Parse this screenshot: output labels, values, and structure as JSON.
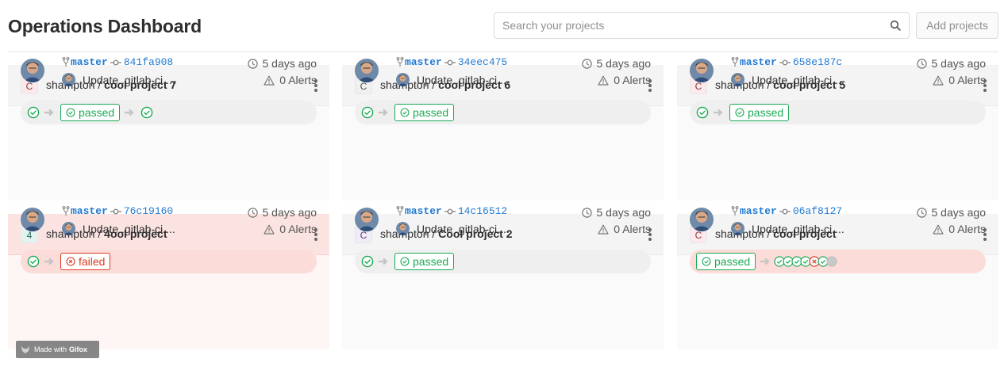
{
  "header": {
    "title": "Operations Dashboard",
    "search_placeholder": "Search your projects",
    "add_label": "Add projects"
  },
  "colors": {
    "passed": "#1aaa55",
    "failed": "#db3b21",
    "link": "#1f78d1"
  },
  "projects": [
    {
      "avatar": "C",
      "owner": "shampton",
      "name": "cool project 7",
      "branch": "master",
      "sha": "841fa908",
      "commit": "Update .gitlab-ci....",
      "time": "5 days ago",
      "alerts": "0 Alerts",
      "status": "passed"
    },
    {
      "avatar": "C",
      "owner": "shampton",
      "name": "cool project 6",
      "branch": "master",
      "sha": "34eec475",
      "commit": "Update .gitlab-ci....",
      "time": "5 days ago",
      "alerts": "0 Alerts",
      "status": "passed"
    },
    {
      "avatar": "C",
      "owner": "shampton",
      "name": "cool project 5",
      "branch": "master",
      "sha": "658e187c",
      "commit": "Update .gitlab-ci....",
      "time": "5 days ago",
      "alerts": "0 Alerts",
      "status": "passed"
    },
    {
      "avatar": "4",
      "owner": "shampton",
      "name": "4ool project",
      "branch": "master",
      "sha": "76c19160",
      "commit": "Update .gitlab-ci....",
      "time": "5 days ago",
      "alerts": "0 Alerts",
      "status": "failed"
    },
    {
      "avatar": "C",
      "owner": "shampton",
      "name": "Cool project 2",
      "branch": "master",
      "sha": "14c16512",
      "commit": "Update .gitlab-ci....",
      "time": "5 days ago",
      "alerts": "0 Alerts",
      "status": "passed"
    },
    {
      "avatar": "C",
      "owner": "shampton",
      "name": "cool project",
      "branch": "master",
      "sha": "06af8127",
      "commit": "Update .gitlab-ci....",
      "time": "5 days ago",
      "alerts": "0 Alerts",
      "status": "passed"
    }
  ],
  "watermark": {
    "prefix": "Made with",
    "brand": "Gifox"
  }
}
